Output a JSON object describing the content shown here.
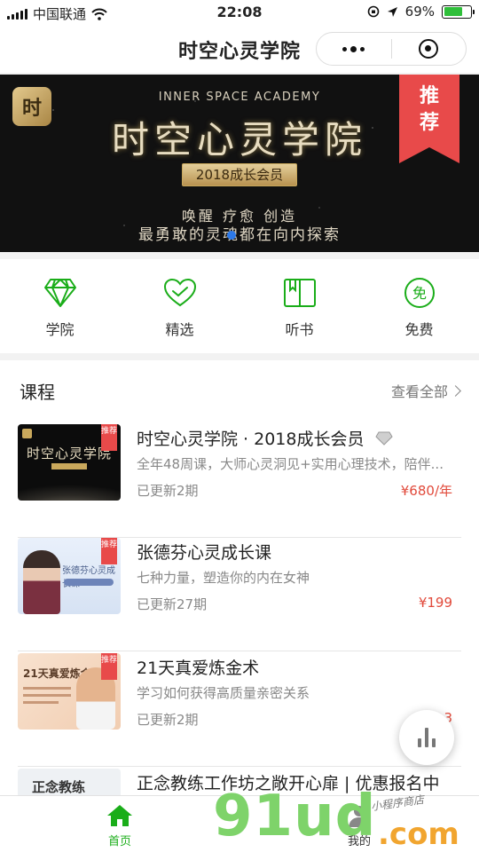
{
  "status_bar": {
    "carrier": "中国联通",
    "time": "22:08",
    "battery": "69%",
    "battery_level": 0.69
  },
  "nav_bar": {
    "title": "时空心灵学院"
  },
  "banner": {
    "english": "INNER SPACE ACADEMY",
    "title": "时空心灵学院",
    "badge": "推荐",
    "member": "2018成长会员",
    "slogan_line1": "唤醒 疗愈 创造",
    "slogan_line2": "最勇敢的灵魂都在向内探索"
  },
  "categories": [
    {
      "label": "学院",
      "icon": "diamond-icon"
    },
    {
      "label": "精选",
      "icon": "heart-check-icon"
    },
    {
      "label": "听书",
      "icon": "book-icon"
    },
    {
      "label": "免费",
      "icon": "free-badge-icon",
      "glyph": "免"
    }
  ],
  "courses_section": {
    "title": "课程",
    "view_all": "查看全部",
    "items": [
      {
        "title": "时空心灵学院 · 2018成长会员",
        "desc": "全年48周课，大师心灵洞见+实用心理技术，陪伴...",
        "updated": "已更新2期",
        "price": "¥680/年"
      },
      {
        "title": "张德芬心灵成长课",
        "desc": "七种力量，塑造你的内在女神",
        "updated": "已更新27期",
        "price": "¥199",
        "thumb_text": "张德芬心灵成长课"
      },
      {
        "title": "21天真爱炼金术",
        "desc": "学习如何获得高质量亲密关系",
        "updated": "已更新2期",
        "price": "3",
        "thumb_text": "21天真爱炼金术"
      },
      {
        "title": "正念教练工作坊之敞开心扉 | 优惠报名中",
        "thumb_text": "正念教练"
      }
    ]
  },
  "thumb_badge": "推荐",
  "tab_bar": [
    {
      "label": "首页",
      "icon": "home-icon",
      "active": true
    },
    {
      "label": "我的",
      "icon": "user-icon",
      "active": false
    }
  ],
  "watermark": {
    "main": "91ud",
    "domain": ".com",
    "small": "小程序商店"
  },
  "colors": {
    "brand_green": "#1aad19",
    "price_red": "#e14a3b",
    "ribbon_red": "#e84a4a"
  }
}
